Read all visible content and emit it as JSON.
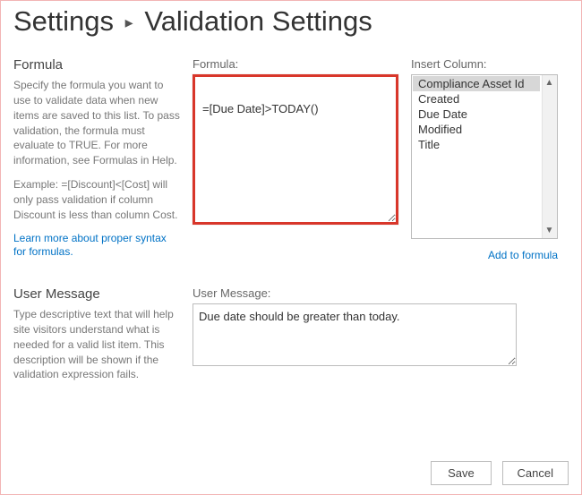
{
  "breadcrumb": {
    "root": "Settings",
    "sep": "▸",
    "page": "Validation Settings"
  },
  "formula_section": {
    "title": "Formula",
    "desc": "Specify the formula you want to use to validate data when new items are saved to this list. To pass validation, the formula must evaluate to TRUE. For more information, see Formulas in Help.",
    "example": "Example: =[Discount]<[Cost] will only pass validation if column Discount is less than column Cost.",
    "link": "Learn more about proper syntax for formulas.",
    "label": "Formula:",
    "value": "=[Due Date]>TODAY()"
  },
  "columns": {
    "label": "Insert Column:",
    "items": [
      "Compliance Asset Id",
      "Created",
      "Due Date",
      "Modified",
      "Title"
    ],
    "selected": "Compliance Asset Id",
    "add_link": "Add to formula"
  },
  "usermsg_section": {
    "title": "User Message",
    "desc": "Type descriptive text that will help site visitors understand what is needed for a valid list item. This description will be shown if the validation expression fails.",
    "label": "User Message:",
    "value": "Due date should be greater than today."
  },
  "buttons": {
    "save": "Save",
    "cancel": "Cancel"
  }
}
